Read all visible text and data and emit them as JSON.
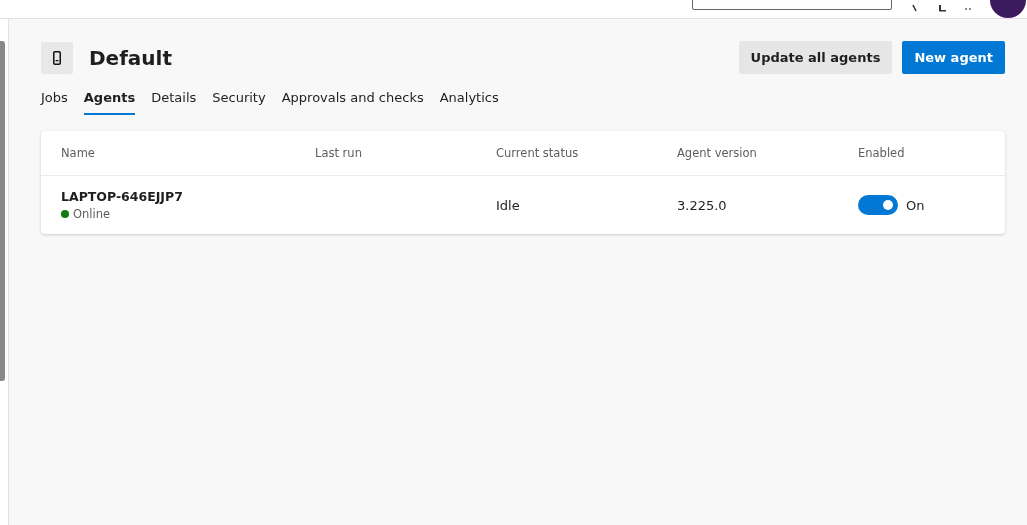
{
  "pool": {
    "title": "Default"
  },
  "buttons": [
    {
      "label": "Update all agents",
      "kind": "secondary"
    },
    {
      "label": "New agent",
      "kind": "primary"
    }
  ],
  "tabs": [
    {
      "label": "Jobs",
      "selected": false
    },
    {
      "label": "Agents",
      "selected": true
    },
    {
      "label": "Details",
      "selected": false
    },
    {
      "label": "Security",
      "selected": false
    },
    {
      "label": "Approvals and checks",
      "selected": false
    },
    {
      "label": "Analytics",
      "selected": false
    }
  ],
  "table": {
    "columns": [
      "Name",
      "Last run",
      "Current status",
      "Agent version",
      "Enabled"
    ],
    "rows": [
      {
        "name": "LAPTOP-646EJJP7",
        "connection": {
          "label": "Online",
          "color": "#107c10"
        },
        "current_status": "Idle",
        "agent_version": "3.225.0",
        "enabled": {
          "on": true,
          "label": "On"
        }
      }
    ]
  }
}
